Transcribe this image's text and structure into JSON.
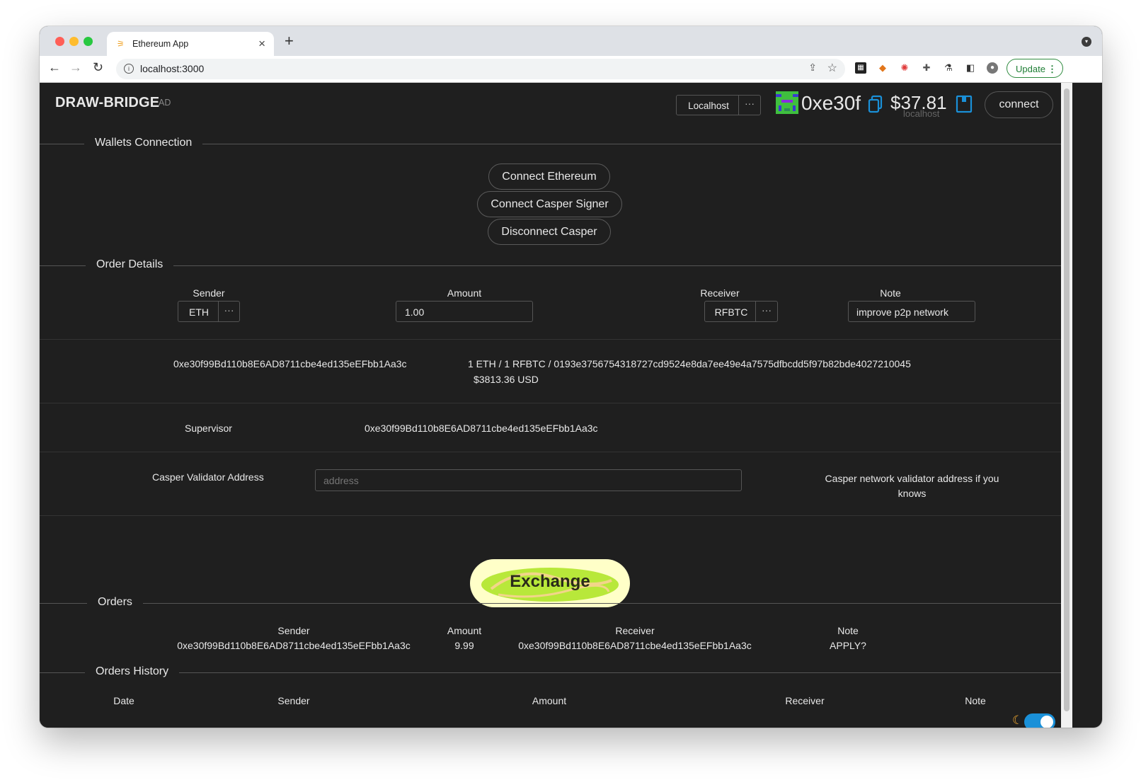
{
  "browser": {
    "tab_title": "Ethereum App",
    "url": "localhost:3000",
    "update_label": "Update"
  },
  "header": {
    "brand": "DRAW-BRIDGE",
    "brand_sub": "AD",
    "network": "Localhost",
    "network_more": "···",
    "address_short": "0xe30f",
    "balance": "$37.81",
    "balance_network": "localhost",
    "connect_label": "connect"
  },
  "wallets": {
    "title": "Wallets Connection",
    "connect_ethereum": "Connect Ethereum",
    "connect_casper": "Connect Casper Signer",
    "disconnect_casper": "Disconnect Casper"
  },
  "order": {
    "title": "Order Details",
    "sender_label": "Sender",
    "sender_value": "ETH",
    "more": "···",
    "amount_label": "Amount",
    "amount_value": "1.00",
    "receiver_label": "Receiver",
    "receiver_value": "RFBTC",
    "note_label": "Note",
    "note_value": "improve p2p network",
    "sender_address": "0xe30f99Bd110b8E6AD8711cbe4ed135eEFbb1Aa3c",
    "rate_line": "1 ETH / 1 RFBTC / 0193e3756754318727cd9524e8da7ee49e4a7575dfbcdd5f97b82bde4027210045",
    "usd_line": "$3813.36 USD",
    "supervisor_label": "Supervisor",
    "supervisor_address": "0xe30f99Bd110b8E6AD8711cbe4ed135eEFbb1Aa3c",
    "validator_label": "Casper Validator Address",
    "validator_placeholder": "address",
    "validator_help": "Casper network validator address if you knows",
    "exchange_label": "Exchange"
  },
  "orders": {
    "title": "Orders",
    "headers": {
      "sender": "Sender",
      "amount": "Amount",
      "receiver": "Receiver",
      "note": "Note"
    },
    "rows": [
      {
        "sender": "0xe30f99Bd110b8E6AD8711cbe4ed135eEFbb1Aa3c",
        "amount": "9.99",
        "receiver": "0xe30f99Bd110b8E6AD8711cbe4ed135eEFbb1Aa3c",
        "note": "APPLY?"
      }
    ]
  },
  "history": {
    "title": "Orders History",
    "headers": {
      "date": "Date",
      "sender": "Sender",
      "amount": "Amount",
      "receiver": "Receiver",
      "note": "Note"
    }
  },
  "theme": {
    "dark_mode": true,
    "accent": "#1a90d8"
  }
}
